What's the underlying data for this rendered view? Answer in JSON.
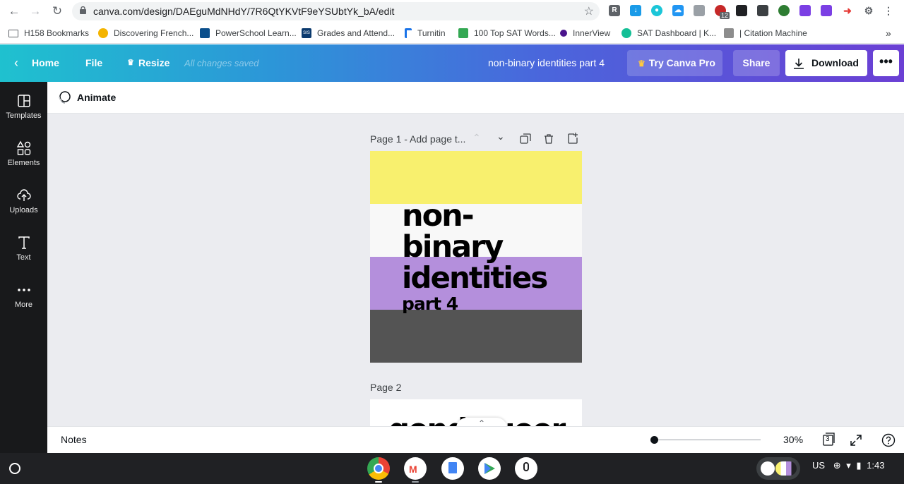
{
  "browser": {
    "url": "canva.com/design/DAEguMdNHdY/7R6QtYKVtF9eYSUbtYk_bA/edit",
    "extension_badge": "12",
    "bookmarks": [
      {
        "label": "H158 Bookmarks",
        "icon": "folder-icon"
      },
      {
        "label": "Discovering French...",
        "icon": "circle-icon"
      },
      {
        "label": "PowerSchool Learn...",
        "icon": "powerschool-icon"
      },
      {
        "label": "Grades and Attend...",
        "icon": "sis-icon"
      },
      {
        "label": "Turnitin",
        "icon": "turnitin-icon"
      },
      {
        "label": "100 Top SAT Words...",
        "icon": "check-icon"
      },
      {
        "label": "InnerView",
        "icon": "innerview-icon"
      },
      {
        "label": "SAT Dashboard | K...",
        "icon": "khan-icon"
      },
      {
        "label": "| Citation Machine",
        "icon": "citation-icon"
      }
    ],
    "sis_fav_text": "SIS",
    "bookmarks_overflow": "»"
  },
  "header": {
    "home": "Home",
    "file": "File",
    "resize": "Resize",
    "saved_status": "All changes saved",
    "design_title": "non-binary identities part 4",
    "try_pro": "Try Canva Pro",
    "share": "Share",
    "download": "Download",
    "more": "•••"
  },
  "sidebar": {
    "items": [
      {
        "label": "Templates",
        "icon": "templates-icon"
      },
      {
        "label": "Elements",
        "icon": "elements-icon"
      },
      {
        "label": "Uploads",
        "icon": "uploads-icon"
      },
      {
        "label": "Text",
        "icon": "text-icon"
      },
      {
        "label": "More",
        "icon": "more-icon"
      }
    ]
  },
  "toolbar": {
    "animate": "Animate"
  },
  "pages": [
    {
      "label": "Page 1 - Add page t...",
      "text_lines": [
        "non-",
        "binary",
        "identities"
      ],
      "subtitle": "part 4",
      "stripe_colors": [
        "#f8f06e",
        "#f8f8f8",
        "#b48fdc",
        "#545454"
      ]
    },
    {
      "label": "Page 2",
      "text_fragment": "gende ueer"
    }
  ],
  "footer": {
    "notes": "Notes",
    "zoom": "30%",
    "page_count": "3"
  },
  "system": {
    "locale": "US",
    "time": "1:43"
  }
}
